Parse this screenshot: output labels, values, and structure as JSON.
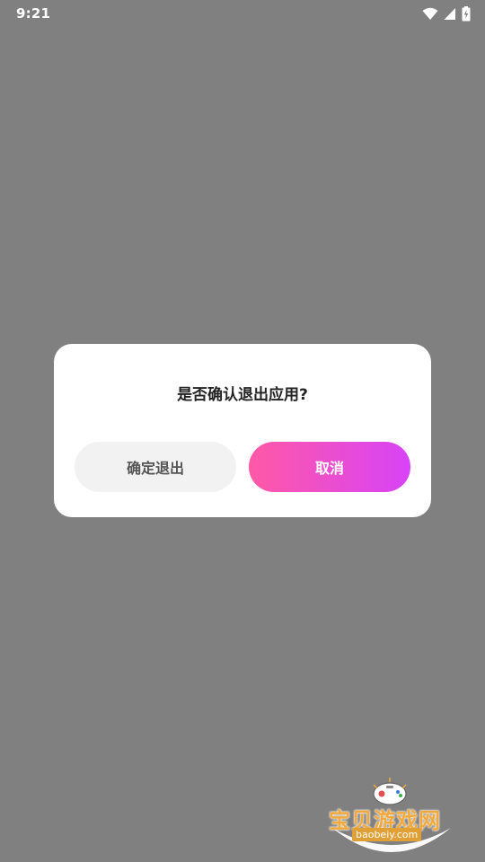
{
  "status_bar": {
    "time": "9:21",
    "icons": [
      "wifi-icon",
      "cell-signal-icon",
      "battery-charging-icon"
    ]
  },
  "dialog": {
    "title": "是否确认退出应用?",
    "confirm_label": "确定退出",
    "cancel_label": "取消"
  },
  "watermark": {
    "brand": "宝贝游戏网",
    "domain": "baobeiy.com"
  },
  "colors": {
    "overlay": "#808080",
    "dialog_bg": "#ffffff",
    "confirm_bg": "#f2f2f2",
    "cancel_gradient_start": "#ff59a6",
    "cancel_gradient_end": "#d743f7"
  }
}
